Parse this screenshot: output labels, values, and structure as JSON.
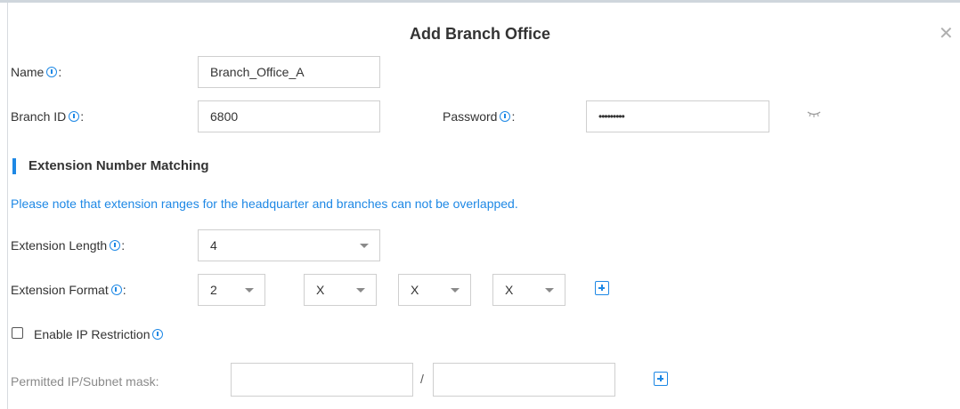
{
  "dialog": {
    "title": "Add Branch Office",
    "close_icon": "close-icon"
  },
  "form": {
    "name": {
      "label": "Name",
      "value": "Branch_Office_A"
    },
    "branch_id": {
      "label": "Branch ID",
      "value": "6800"
    },
    "password": {
      "label": "Password",
      "value": "•••••••••",
      "toggle_icon": "eye-hidden-icon"
    },
    "colon": ":"
  },
  "section": {
    "title": "Extension Number Matching",
    "note": "Please note that extension ranges for the headquarter and branches can not be overlapped."
  },
  "extension": {
    "length_label": "Extension Length",
    "length_value": "4",
    "format_label": "Extension Format",
    "format_values": [
      "2",
      "X",
      "X",
      "X"
    ],
    "add_icon": "plus-icon"
  },
  "ip_restriction": {
    "label": "Enable IP Restriction",
    "checked": false,
    "permitted_label": "Permitted IP/Subnet mask:",
    "ip_value": "",
    "mask_value": "",
    "separator": "/",
    "add_icon": "plus-icon"
  },
  "colors": {
    "accent": "#1e88e5",
    "text": "#333333",
    "border": "#cfcfcf"
  }
}
